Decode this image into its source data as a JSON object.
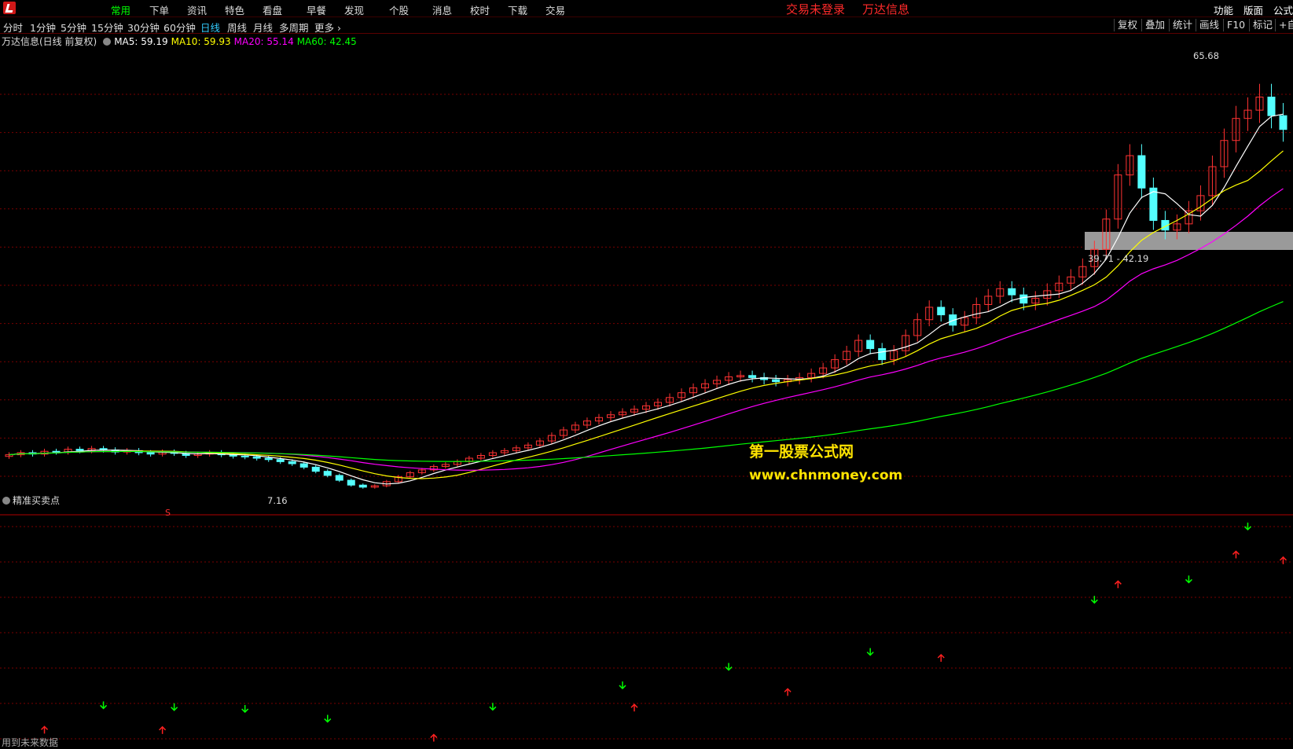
{
  "menubar": {
    "items": [
      {
        "label": "常用",
        "active": true
      },
      {
        "label": "下单",
        "active": false
      },
      {
        "label": "资讯",
        "active": false
      },
      {
        "label": "特色",
        "active": false
      },
      {
        "label": "看盘",
        "active": false
      },
      {
        "label": "早餐",
        "active": false
      },
      {
        "label": "发现",
        "active": false
      },
      {
        "label": "个股",
        "active": false
      },
      {
        "label": "消息",
        "active": false
      },
      {
        "label": "校时",
        "active": false
      },
      {
        "label": "下载",
        "active": false
      },
      {
        "label": "交易",
        "active": false
      }
    ],
    "login_status": "交易未登录",
    "brand": "万达信息",
    "right_items": [
      "功能",
      "版面",
      "公式"
    ]
  },
  "periodbar": {
    "periods": [
      "分时",
      "1分钟",
      "5分钟",
      "15分钟",
      "30分钟",
      "60分钟",
      "日线",
      "周线",
      "月线",
      "多周期",
      "更多"
    ],
    "active": "日线",
    "tools": [
      "复权",
      "叠加",
      "统计",
      "画线",
      "F10",
      "标记",
      "+自"
    ]
  },
  "chart": {
    "stock_title": "万达信息(日线 前复权)",
    "ma": [
      {
        "label": "MA5: 59.19",
        "color": "#ffffff"
      },
      {
        "label": "MA10: 59.93",
        "color": "#ffff00"
      },
      {
        "label": "MA20: 55.14",
        "color": "#ff00ff"
      },
      {
        "label": "MA60: 42.45",
        "color": "#00ff00"
      }
    ],
    "high_label": "65.68",
    "low_label": "7.16",
    "range_label": "39.71 - 42.19",
    "sell_marker": "S"
  },
  "sub_panel": {
    "title": "精准买卖点",
    "footer": "用到未来数据"
  },
  "watermark": {
    "cn": "第一股票公式网",
    "url": "www.chnmoney.com"
  },
  "colors": {
    "up": "#ff3333",
    "down": "#54ffff",
    "grid": "#7a0000",
    "ma5": "#ffffff",
    "ma10": "#ffff00",
    "ma20": "#ff00ff",
    "ma60": "#00ff00",
    "buy_arrow": "#ff2020",
    "sell_arrow": "#00ff00"
  },
  "chart_data": {
    "type": "candlestick",
    "price_range": [
      5,
      70
    ],
    "closes": [
      12.0,
      12.3,
      12.1,
      12.5,
      12.4,
      12.8,
      12.6,
      12.9,
      12.7,
      12.4,
      12.6,
      12.3,
      12.1,
      12.4,
      12.2,
      11.9,
      12.1,
      12.3,
      12.0,
      11.8,
      11.7,
      11.5,
      11.3,
      11.0,
      10.7,
      10.2,
      9.6,
      9.0,
      8.3,
      7.6,
      7.3,
      7.5,
      8.1,
      8.8,
      9.4,
      9.8,
      10.3,
      10.6,
      11.0,
      11.5,
      11.9,
      12.3,
      12.6,
      13.0,
      13.4,
      14.0,
      14.8,
      15.6,
      16.3,
      16.9,
      17.4,
      17.8,
      18.2,
      18.6,
      19.1,
      19.6,
      20.3,
      21.0,
      21.7,
      22.3,
      22.8,
      23.3,
      23.5,
      23.2,
      22.9,
      22.6,
      22.9,
      23.2,
      23.8,
      24.6,
      25.8,
      27.0,
      28.6,
      27.4,
      25.8,
      27.1,
      29.3,
      31.6,
      33.4,
      32.3,
      30.8,
      31.9,
      33.8,
      35.0,
      36.1,
      35.2,
      34.0,
      34.7,
      35.8,
      36.9,
      37.8,
      39.3,
      41.8,
      46.2,
      52.6,
      55.4,
      50.7,
      46.0,
      44.6,
      45.5,
      47.4,
      49.6,
      53.8,
      57.6,
      60.8,
      62.0,
      63.9,
      61.2,
      59.2
    ],
    "buy_signals": [
      3,
      13,
      36,
      53,
      66,
      79,
      94,
      104,
      108
    ],
    "sell_signals": [
      8,
      14,
      20,
      27,
      41,
      52,
      61,
      73,
      92,
      100,
      105,
      110
    ]
  }
}
